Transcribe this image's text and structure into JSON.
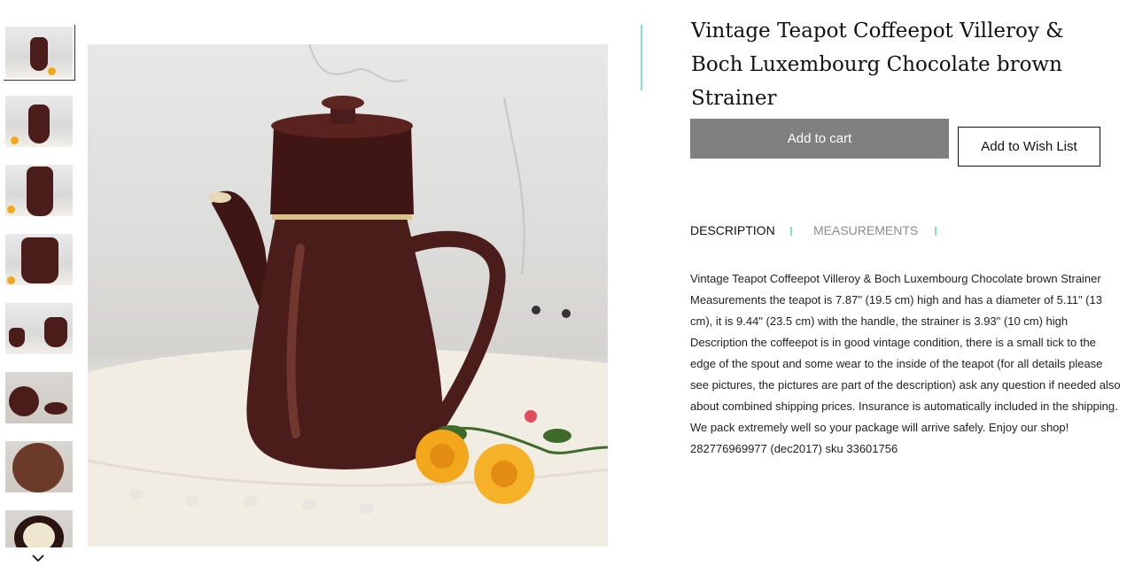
{
  "product": {
    "title": "Vintage Teapot Coffeepot Villeroy & Boch Luxembourg Chocolate brown Strainer",
    "add_to_cart_label": "Add to cart",
    "add_to_wishlist_label": "Add to Wish List",
    "description": "Vintage Teapot Coffeepot Villeroy & Boch Luxembourg Chocolate brown Strainer Measurements the teapot is 7.87\" (19.5 cm) high and has a diameter of 5.11\" (13 cm), it is 9.44\" (23.5 cm) with the handle, the strainer is 3.93\" (10 cm) high Description the coffeepot is in good vintage condition, there is a small tick to the edge of the spout and some wear to the inside of the teapot (for all details please see pictures, the pictures are part of the description) ask any question if needed also about combined shipping prices. Insurance is automatically included in the shipping. We pack extremely well so your package will arrive safely. Enjoy our shop! 282776969977 (dec2017) sku 33601756"
  },
  "tabs": [
    {
      "label": "DESCRIPTION",
      "active": true
    },
    {
      "label": "MEASUREMENTS",
      "active": false
    }
  ],
  "gallery": {
    "thumbnail_count": 8,
    "active_index": 0,
    "scroll_icon": "chevron-down-icon"
  },
  "colors": {
    "accent": "#7fe2cf",
    "cart_button": "#808080",
    "teapot": "#4a1c1a",
    "flower": "#f3a71b"
  }
}
